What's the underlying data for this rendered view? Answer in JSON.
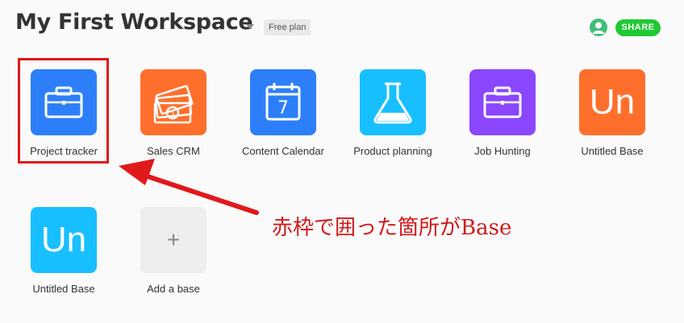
{
  "header": {
    "workspace_title": "My First Workspace",
    "plan_badge": "Free plan",
    "share_label": "SHARE"
  },
  "bases": [
    {
      "label": "Project tracker",
      "color": "#2d7ff9",
      "icon": "briefcase-icon"
    },
    {
      "label": "Sales CRM",
      "color": "#ff6f2c",
      "icon": "money-icon"
    },
    {
      "label": "Content Calendar",
      "color": "#2d7ff9",
      "icon": "calendar-icon",
      "calendar_day": "7"
    },
    {
      "label": "Product planning",
      "color": "#18bfff",
      "icon": "flask-icon"
    },
    {
      "label": "Job Hunting",
      "color": "#8b46ff",
      "icon": "briefcase-icon"
    },
    {
      "label": "Untitled Base",
      "color": "#ff6f2c",
      "icon": "initials",
      "initials": "Un"
    },
    {
      "label": "Untitled Base",
      "color": "#18bfff",
      "icon": "initials",
      "initials": "Un"
    }
  ],
  "add_base": {
    "label": "Add a base",
    "plus": "+",
    "color": "#eeeeee"
  },
  "annotation": {
    "text": "赤枠で囲った箇所がBase",
    "color": "#e0191b"
  },
  "colors": {
    "share": "#20c933",
    "avatar": "#3fbf75"
  }
}
